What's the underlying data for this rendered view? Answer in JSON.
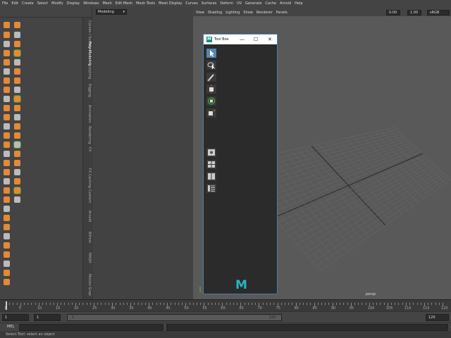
{
  "menu": [
    "File",
    "Edit",
    "Create",
    "Select",
    "Modify",
    "Display",
    "Windows",
    "Mesh",
    "Edit Mesh",
    "Mesh Tools",
    "Mesh Display",
    "Curves",
    "Surfaces",
    "Deform",
    "UV",
    "Generate",
    "Cache",
    "Arnold",
    "Help"
  ],
  "mode_select": "Modeling",
  "shelf_tabs": [
    "Curves / Surfaces",
    "Poly Modeling",
    "Sculpting",
    "Rigging",
    "Animation",
    "Rendering",
    "FX",
    "FX Caching",
    "Custom",
    "Arnold",
    "Bifrost",
    "MASH",
    "Motion Grap"
  ],
  "viewport_menu": [
    "View",
    "Shading",
    "Lighting",
    "Show",
    "Renderer",
    "Panels"
  ],
  "viewport_fields": {
    "exposure": "0.00",
    "gamma": "1.00",
    "colorspace": "sRGB gamma"
  },
  "viewport_label": "persp",
  "toolbox": {
    "title": "Tool Box",
    "logo_letter": "M",
    "min": "—",
    "max": "☐",
    "close": "✕"
  },
  "timeline": {
    "ticks": [
      "1",
      "5",
      "10",
      "15",
      "20",
      "25",
      "30",
      "35",
      "40",
      "45",
      "50",
      "55",
      "60",
      "65",
      "70",
      "75",
      "80",
      "85",
      "90",
      "95",
      "100",
      "105",
      "110",
      "115",
      "120"
    ],
    "current_frame": "1"
  },
  "range": {
    "start": "1",
    "anim_start": "1",
    "range_start": "1",
    "range_end": "120",
    "end": "120"
  },
  "mel_label": "MEL",
  "help_text": "Select Tool: select an object",
  "colors": {
    "accent": "#5287b3",
    "logo": "#26b5c4",
    "shelf_orange": "#e38a38"
  }
}
